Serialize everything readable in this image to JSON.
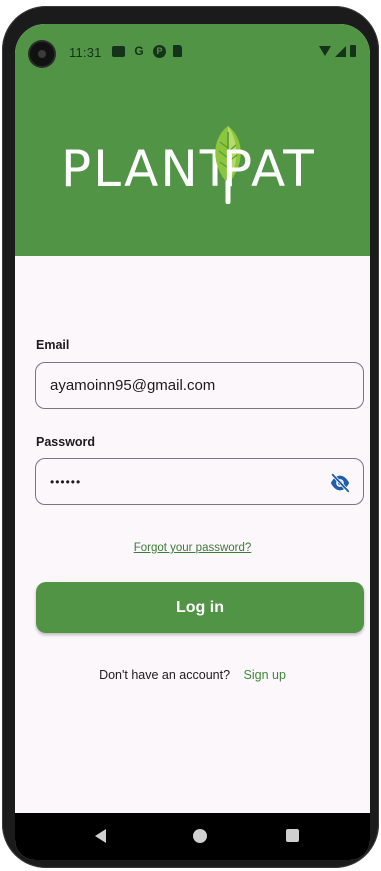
{
  "status_bar": {
    "time": "11:31",
    "icons": [
      "gallery-icon",
      "google-icon",
      "app-icon",
      "sim-card-icon"
    ],
    "right_icons": [
      "wifi-icon",
      "signal-icon",
      "battery-icon"
    ]
  },
  "header": {
    "logo_left": "PLANT",
    "logo_right": "PAT",
    "background_color": "#529445"
  },
  "form": {
    "email_label": "Email",
    "email_value": "ayamoinn95@gmail.com",
    "password_label": "Password",
    "password_value": "••••••",
    "password_visibility_icon": "eye-off-icon",
    "forgot_password": "Forgot your password?",
    "login_button": "Log in"
  },
  "footer": {
    "no_account_text": "Don't have an account?",
    "signup_link": "Sign up"
  },
  "nav": {
    "icons": [
      "back-icon",
      "home-icon",
      "recents-icon"
    ]
  },
  "colors": {
    "accent": "#529445",
    "link": "#3e7a38",
    "background": "#fbf7fb",
    "icon_blue": "#1e5fa8"
  }
}
